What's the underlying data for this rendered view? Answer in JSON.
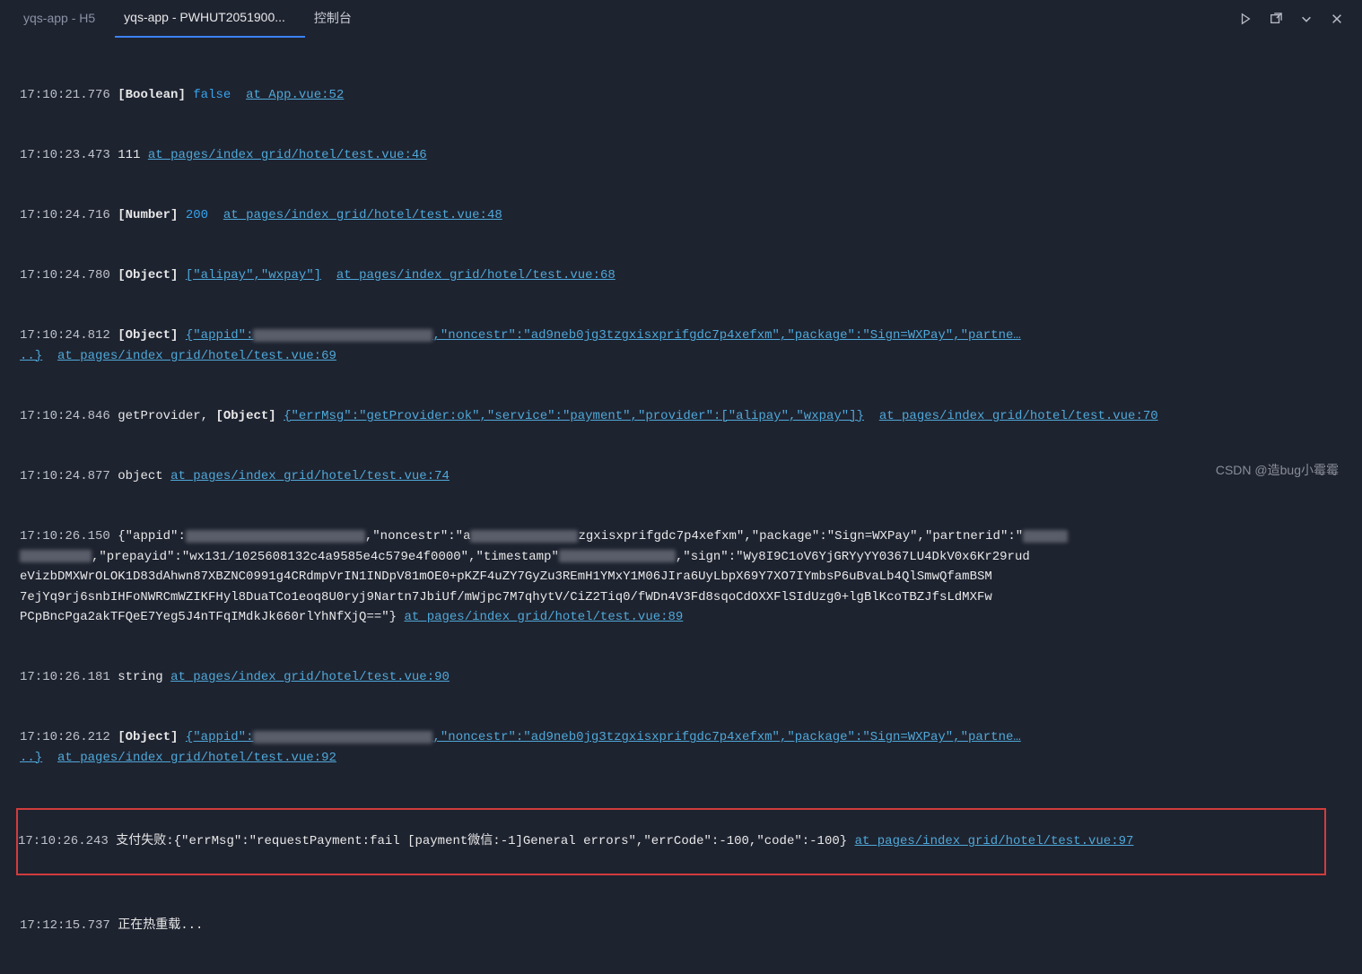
{
  "tabs": {
    "t1": "yqs-app - H5",
    "t2": "yqs-app - PWHUT2051900...",
    "t3": "控制台"
  },
  "log": {
    "r1": {
      "ts": "17:10:21.776",
      "type": "[Boolean]",
      "val": "false",
      "link": "at App.vue:52"
    },
    "r2": {
      "ts": "17:10:23.473",
      "txt": "111",
      "link": "at pages/index_grid/hotel/test.vue:46"
    },
    "r3": {
      "ts": "17:10:24.716",
      "type": "[Number]",
      "val": "200",
      "link": "at pages/index_grid/hotel/test.vue:48"
    },
    "r4": {
      "ts": "17:10:24.780",
      "type": "[Object]",
      "obj": "[\"alipay\",\"wxpay\"]",
      "mid": "at pages/",
      "link": "index_grid/hotel/test.vue:68"
    },
    "r5": {
      "ts": "17:10:24.812",
      "type": "[Object]",
      "obj1": "{\"appid\":",
      "obj2": ",\"noncestr\":\"ad9neb0jg3tzgxisxprifgdc7p4xefxm\",\"package\":\"Sign=WXPay\",\"partne…",
      "cont": "..}",
      "link": "at pages/index_grid/hotel/test.vue:69"
    },
    "r6": {
      "ts": "17:10:24.846",
      "txt": "getProvider,",
      "type": "[Object]",
      "obj": "{\"errMsg\":\"getProvider:ok\",\"service\":\"payment\",\"provider\":[\"alipay\",\"wxpay\"]}",
      "link": "at pages/index_grid/hotel/test.vue:70"
    },
    "r7": {
      "ts": "17:10:24.877",
      "txt": "object",
      "link": "at pages/index_grid/hotel/test.vue:74"
    },
    "r8": {
      "ts": "17:10:26.150",
      "a": "{\"appid\":",
      "b": ",\"noncestr\":\"a",
      "c": "zgxisxprifgdc7p4xefxm\",\"package\":\"Sign=WXPay\",\"partnerid\":\"",
      "d": ",\"prepayid\":\"wx131/1025608132c4a9585e4c579e4f0000\",\"timestamp\"",
      "e": ",\"sign\":\"Wy8I9C1oV6YjGRYyYY0367LU4DkV0x6Kr29rud",
      "f": "eVizbDMXWrOLOK1D83dAhwn87XBZNC0991g4CRdmpVrIN1INDpV81mOE0+pKZF4uZY7GyZu3REmH1YMxY1M06JIra6UyLbpX69Y7XO7IYmbsP6uBvaLb4QlSmwQfamBSM",
      "g": "7ejYq9rj6snbIHFoNWRCmWZIKFHyl8DuaTCo1eoq8U0ryj9Nartn7JbiUf/mWjpc7M7qhytV/CiZ2Tiq0/fWDn4V3Fd8sqoCdOXXFlSIdUzg0+lgBlKcoTBZJfsLdMXFw",
      "h": "PCpBncPga2akTFQeE7Yeg5J4nTFqIMdkJk660rlYhNfXjQ==\"}",
      "link": "at pages/index_grid/hotel/test.vue:89"
    },
    "r9": {
      "ts": "17:10:26.181",
      "txt": "string",
      "link": "at pages/index_grid/hotel/test.vue:90"
    },
    "r10": {
      "ts": "17:10:26.212",
      "type": "[Object]",
      "obj1": "{\"appid\":",
      "obj2": ",\"noncestr\":\"ad9neb0jg3tzgxisxprifgdc7p4xefxm\",\"package\":\"Sign=WXPay\",\"partne…",
      "cont": "..}",
      "link": "at pages/index_grid/hotel/test.vue:92"
    },
    "r11": {
      "ts": "17:10:26.243",
      "txt": "支付失败:{\"errMsg\":\"requestPayment:fail [payment微信:-1]General errors\",\"errCode\":-100,\"code\":-100}",
      "link": "at pages/index_grid/hotel/test.vue:97"
    },
    "r12": {
      "ts": "17:12:15.737",
      "txt": "正在热重载..."
    }
  },
  "watermark": "CSDN @造bug小霉霉"
}
